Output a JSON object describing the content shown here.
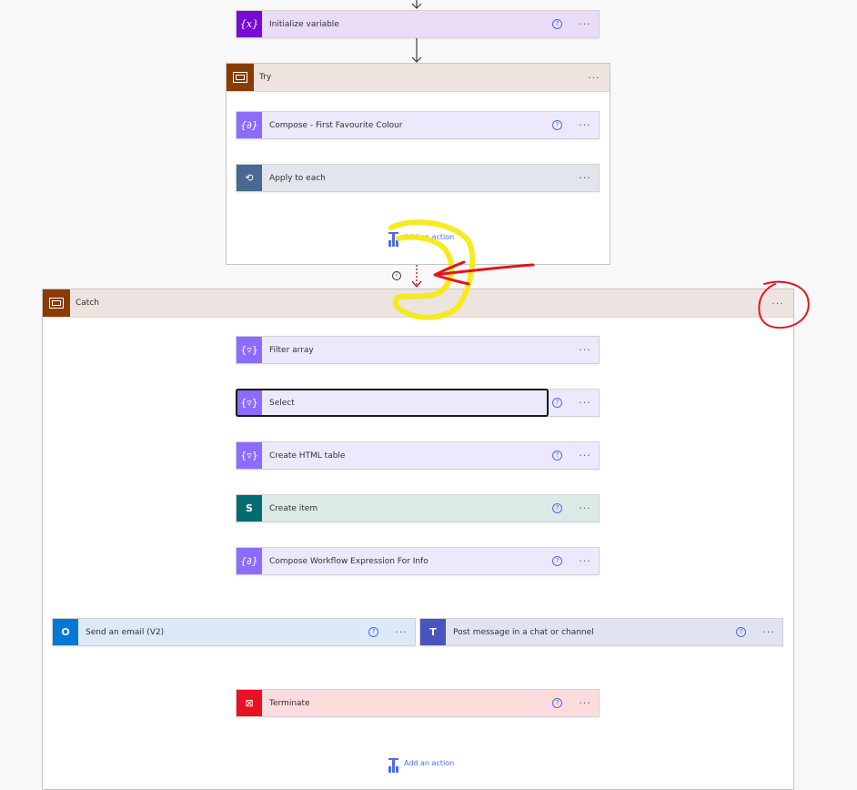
{
  "colors": {
    "variable": "#770bd6",
    "data_ops": "#8c6cff",
    "control": "#486991",
    "scope": "#8a3b00",
    "sharepoint": "#036c70",
    "outlook": "#0078d4",
    "teams": "#4b53bc",
    "terminate": "#e81123",
    "annotation_red": "#e0161b",
    "annotation_yellow": "#f5ea14"
  },
  "actions": {
    "init_var": {
      "label": "Initialize variable",
      "icon": "variable-icon"
    },
    "try_scope": {
      "label": "Try",
      "icon": "scope-icon"
    },
    "compose_first": {
      "label": "Compose - First Favourite Colour",
      "icon": "compose-icon"
    },
    "apply_each": {
      "label": "Apply to each",
      "icon": "loop-icon"
    },
    "catch_scope": {
      "label": "Catch",
      "icon": "scope-icon"
    },
    "filter_array": {
      "label": "Filter array",
      "icon": "data-operation-icon"
    },
    "select": {
      "label": "Select",
      "icon": "data-operation-icon"
    },
    "html_table": {
      "label": "Create HTML table",
      "icon": "data-operation-icon"
    },
    "create_item": {
      "label": "Create item",
      "icon": "sharepoint-icon"
    },
    "compose_wf": {
      "label": "Compose Workflow Expression For Info",
      "icon": "compose-icon"
    },
    "send_email": {
      "label": "Send an email (V2)",
      "icon": "outlook-icon"
    },
    "post_message": {
      "label": "Post message in a chat or channel",
      "icon": "teams-icon"
    },
    "terminate": {
      "label": "Terminate",
      "icon": "terminate-icon"
    }
  },
  "ui": {
    "add_action": "Add an action",
    "more": "···",
    "help": "?",
    "info": "i"
  }
}
